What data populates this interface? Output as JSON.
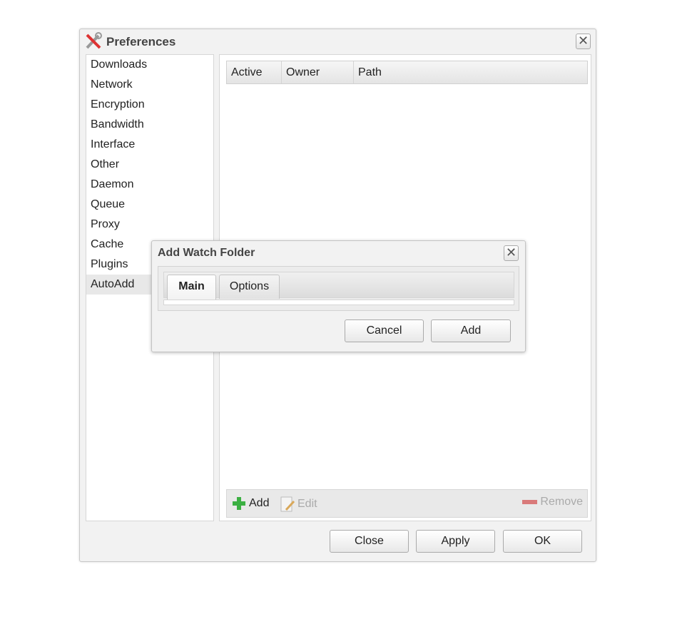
{
  "preferences": {
    "title": "Preferences",
    "icon": "tools-icon",
    "sidebar": [
      "Downloads",
      "Network",
      "Encryption",
      "Bandwidth",
      "Interface",
      "Other",
      "Daemon",
      "Queue",
      "Proxy",
      "Cache",
      "Plugins",
      "AutoAdd"
    ],
    "selected": "AutoAdd",
    "columns": [
      "Active",
      "Owner",
      "Path"
    ],
    "toolbar": {
      "add": "Add",
      "edit": "Edit",
      "remove": "Remove"
    },
    "buttons": {
      "close": "Close",
      "apply": "Apply",
      "ok": "OK"
    }
  },
  "dialog": {
    "title": "Add Watch Folder",
    "tabs": [
      "Main",
      "Options"
    ],
    "active_tab": "Main",
    "buttons": {
      "cancel": "Cancel",
      "add": "Add"
    }
  }
}
